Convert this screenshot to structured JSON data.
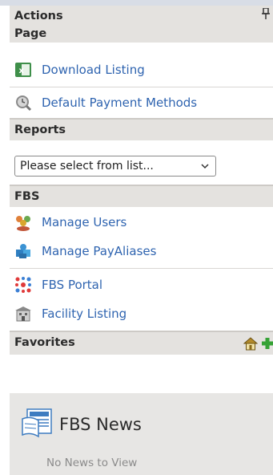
{
  "actions": {
    "header": "Actions",
    "pin_icon": "pin-icon"
  },
  "page": {
    "header": "Page",
    "items": [
      {
        "label": "Download Listing",
        "icon": "excel-icon"
      },
      {
        "label": "Default Payment Methods",
        "icon": "magnifier-icon"
      }
    ]
  },
  "reports": {
    "header": "Reports",
    "select": {
      "selected": "Please select from list..."
    }
  },
  "fbs": {
    "header": "FBS",
    "items": [
      {
        "label": "Manage Users",
        "icon": "users-icon"
      },
      {
        "label": "Manage PayAliases",
        "icon": "puzzle-icon"
      },
      {
        "label": "FBS Portal",
        "icon": "portal-icon"
      },
      {
        "label": "Facility Listing",
        "icon": "building-icon"
      }
    ]
  },
  "favorites": {
    "header": "Favorites",
    "icons": [
      "home-icon",
      "add-icon"
    ]
  },
  "news": {
    "title": "FBS News",
    "empty_text": "No News to View",
    "icon": "newspaper-icon"
  },
  "colors": {
    "link": "#2f64b0",
    "header_bg": "#e4e2df",
    "news_bg": "#e7e6e4"
  }
}
